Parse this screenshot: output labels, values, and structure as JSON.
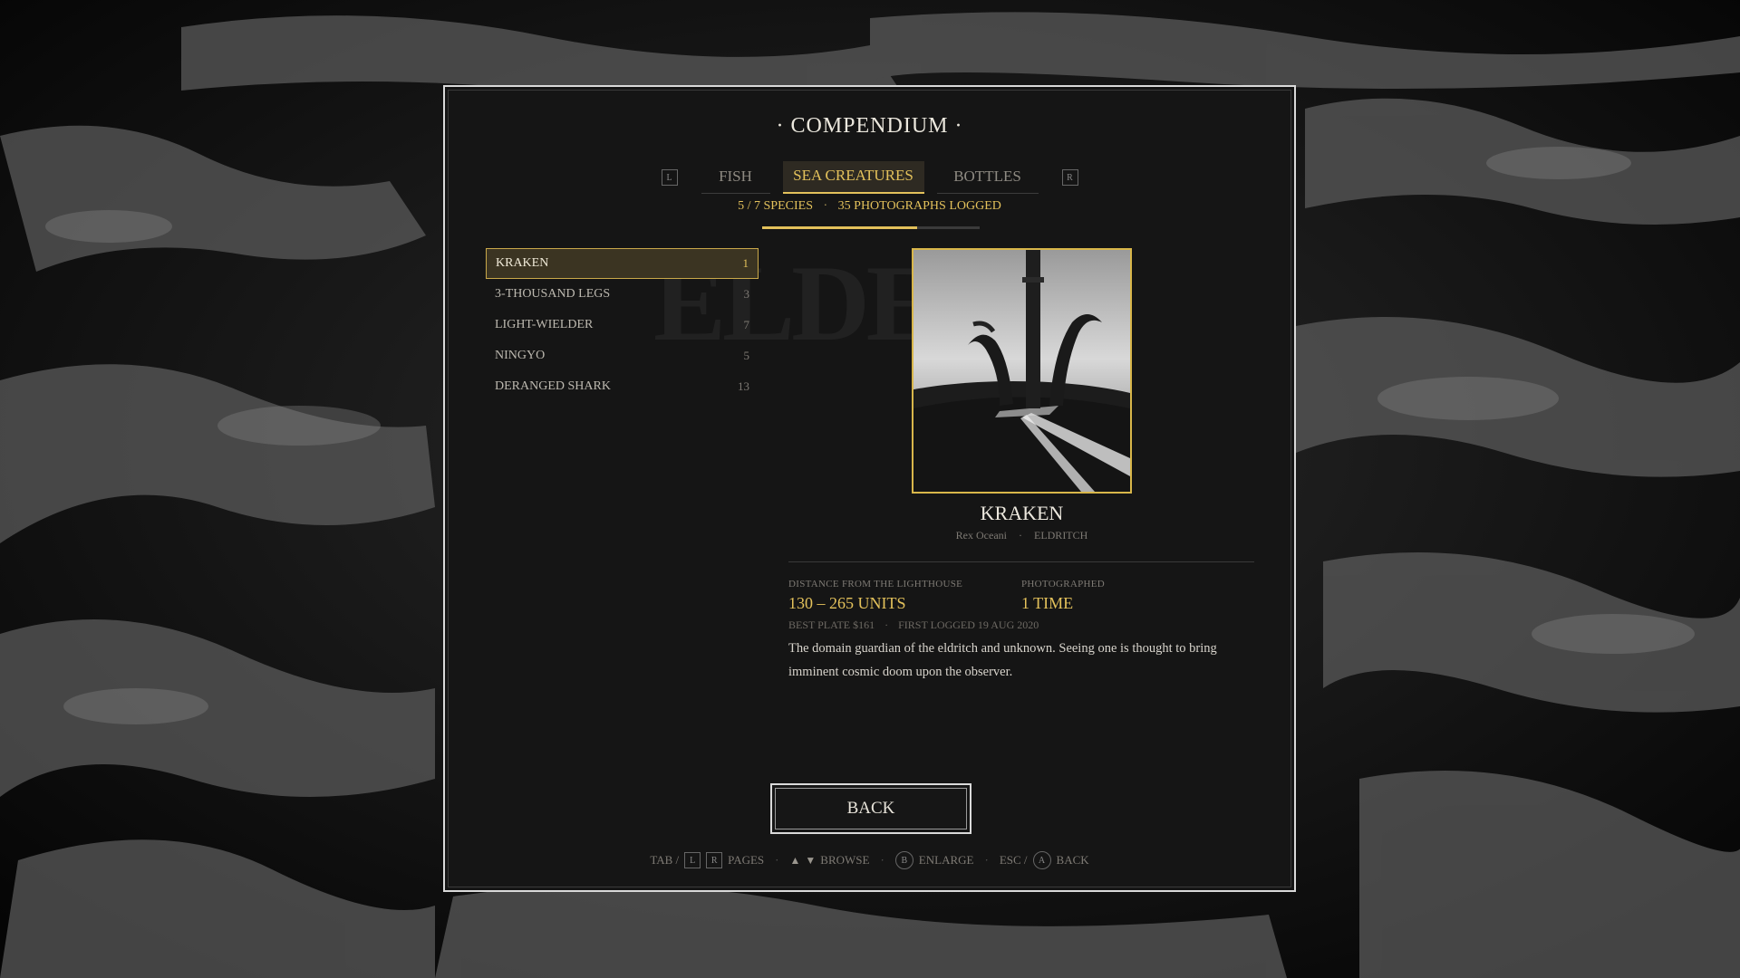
{
  "title": "· COMPENDIUM ·",
  "tabs": {
    "prev_key": "L",
    "next_key": "R",
    "items": [
      {
        "label": "FISH",
        "active": false
      },
      {
        "label": "SEA CREATURES",
        "active": true
      },
      {
        "label": "BOTTLES",
        "active": false
      }
    ]
  },
  "progress": {
    "species": "5 / 7 SPECIES",
    "separator": "·",
    "photographs": "35 PHOTOGRAPHS LOGGED",
    "fraction": 0.714
  },
  "creatures": [
    {
      "name": "KRAKEN",
      "count": "1",
      "selected": true
    },
    {
      "name": "3-THOUSAND LEGS",
      "count": "3",
      "selected": false
    },
    {
      "name": "LIGHT-WIELDER",
      "count": "7",
      "selected": false
    },
    {
      "name": "NINGYO",
      "count": "5",
      "selected": false
    },
    {
      "name": "DERANGED SHARK",
      "count": "13",
      "selected": false
    }
  ],
  "detail": {
    "name": "KRAKEN",
    "latin": "Rex Oceani",
    "separator": "·",
    "class": "ELDRITCH",
    "distance_label": "DISTANCE FROM THE LIGHTHOUSE",
    "distance_value": "130 – 265 UNITS",
    "photographed_label": "PHOTOGRAPHED",
    "photographed_value": "1 TIME",
    "best_plate": "BEST PLATE  $161",
    "first_logged": "FIRST LOGGED  19 AUG 2020",
    "description": "The domain guardian of the eldritch and unknown. Seeing one is thought to bring imminent cosmic doom upon the observer."
  },
  "back_button": "BACK",
  "hints": {
    "tab": "TAB /",
    "key_l": "L",
    "key_r": "R",
    "pages": "PAGES",
    "browse": "BROWSE",
    "key_b": "B",
    "enlarge": "ENLARGE",
    "esc": "ESC /",
    "key_a": "A",
    "back": "BACK",
    "sep": "·"
  },
  "colors": {
    "accent": "#e3c15b",
    "panel": "#151515",
    "border": "#d9d9d9"
  },
  "icons": [
    "up-arrow-icon",
    "down-arrow-icon"
  ]
}
